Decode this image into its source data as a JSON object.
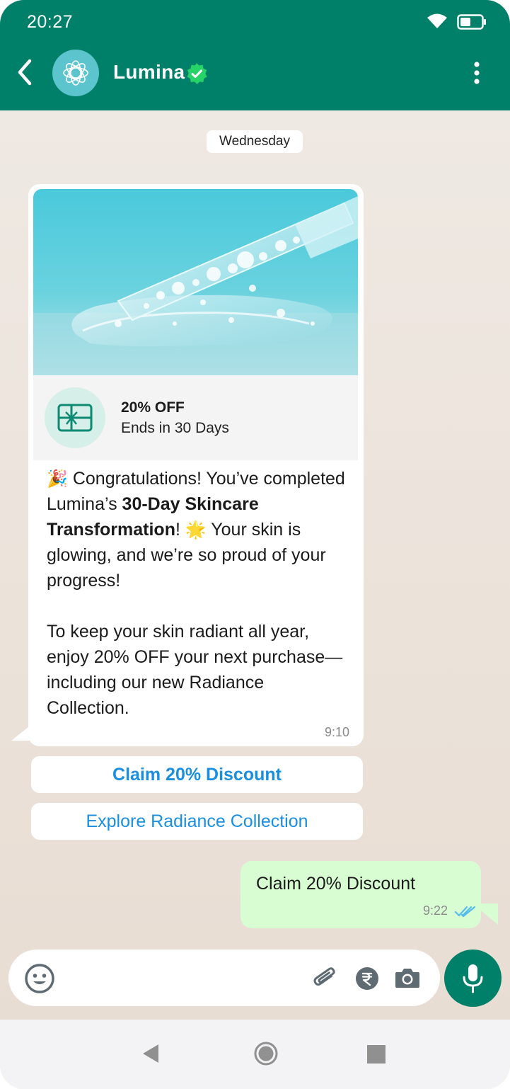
{
  "status_bar": {
    "time": "20:27"
  },
  "header": {
    "contact_name": "Lumina",
    "verified": true,
    "color": "#008069"
  },
  "chat": {
    "date_chip": "Wednesday",
    "incoming_message": {
      "offer_title": "20% OFF",
      "offer_subtitle": "Ends in 30 Days",
      "para1_emoji": "🎉",
      "para1_a": "Congratulations! You’ve completed Lumina’s ",
      "para1_bold": "30-Day Skincare Transformation",
      "para1_b": "!",
      "para1_emoji2": "🌟",
      "para1_c": " Your skin is glowing, and we’re so proud of your progress!",
      "para2": "To keep your skin radiant all year, enjoy 20% OFF your next purchase—including our new Radiance Collection.",
      "time": "9:10"
    },
    "cta_buttons": [
      {
        "label": "Claim 20% Discount"
      },
      {
        "label": "Explore Radiance Collection"
      }
    ],
    "outgoing_message": {
      "text": "Claim 20% Discount",
      "time": "9:22",
      "status": "read"
    }
  },
  "input_bar": {
    "icons": [
      "emoji-icon",
      "attach-icon",
      "rupee-icon",
      "camera-icon",
      "mic-icon"
    ]
  },
  "colors": {
    "accent": "#008069",
    "link": "#1a8fe0",
    "outgoing_bubble": "#d8fdd2",
    "read_ticks": "#53bdeb"
  }
}
